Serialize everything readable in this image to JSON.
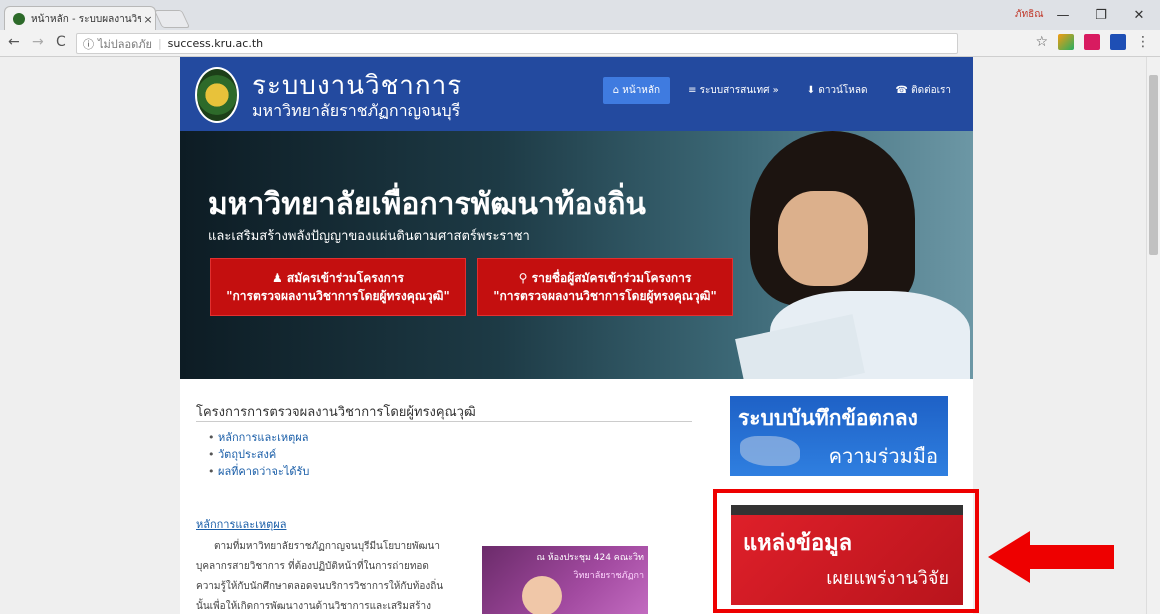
{
  "browser": {
    "tab_title": "หน้าหลัก - ระบบผลงานวิชาก",
    "tab_close": "×",
    "user_name": "ภัทธิณ",
    "window_controls": [
      "—",
      "❐",
      "✕"
    ],
    "nav_back": "←",
    "nav_forward": "→",
    "nav_reload": "C",
    "address_info_icon": "ⓘ",
    "address_security": "ไม่ปลอดภัย",
    "address_separator": "|",
    "address_url": "success.kru.ac.th",
    "bookmark_star": "☆",
    "menu_dots": "⋮"
  },
  "site": {
    "brand_title": "ระบบงานวิชาการ",
    "brand_subtitle": "มหาวิทยาลัยราชภัฏกาญจนบุรี",
    "nav": [
      {
        "label": "⌂ หน้าหลัก"
      },
      {
        "label": "≡ ระบบสารสนเทศ »"
      },
      {
        "label": "⬇ ดาวน์โหลด"
      },
      {
        "label": "☎ ติดต่อเรา"
      }
    ]
  },
  "hero": {
    "title": "มหาวิทยาลัยเพื่อการพัฒนาท้องถิ่น",
    "subtitle": "และเสริมสร้างพลังปัญญาของแผ่นดินตามศาสตร์พระราชา",
    "button1_line1": "♟ สมัครเข้าร่วมโครงการ",
    "button1_line2": "\"การตรวจผลงานวิชาการโดยผู้ทรงคุณวุฒิ\"",
    "button2_line1": "⚲ รายชื่อผู้สมัครเข้าร่วมโครงการ",
    "button2_line2": "\"การตรวจผลงานวิชาการโดยผู้ทรงคุณวุฒิ\""
  },
  "main": {
    "section_title": "โครงการการตรวจผลงานวิชาการโดยผู้ทรงคุณวุฒิ",
    "bullets": [
      "หลักการและเหตุผล",
      "วัตถุประสงค์",
      "ผลที่คาดว่าจะได้รับ"
    ],
    "heading_link": "หลักการและเหตุผล",
    "para_lines": [
      "ตามที่มหาวิทยาลัยราชภัฏกาญจนบุรีมีนโยบายพัฒนา",
      "บุคลากรสายวิชาการ ที่ต้องปฏิบัติหน้าที่ในการถ่ายทอด",
      "ความรู้ให้กับนักศึกษาตลอดจนบริการวิชาการให้กับท้องถิ่น",
      "นั้นเพื่อให้เกิดการพัฒนางานด้านวิชาการและเสริมสร้าง"
    ],
    "photo_caption": "ณ ห้องประชุม 424 คณะวิท",
    "photo_caption2": "วิทยาลัยราชภัฏกา"
  },
  "sidebar": {
    "banner1_title": "ระบบบันทึกข้อตกลง",
    "banner1_sub": "ความร่วมมือ",
    "banner2_title": "แหล่งข้อมูล",
    "banner2_sub": "เผยแพร่งานวิจัย"
  },
  "colors": {
    "header_blue": "#234a9f",
    "hero_button_red": "#c40f0f",
    "highlight_red": "#ee0000"
  }
}
